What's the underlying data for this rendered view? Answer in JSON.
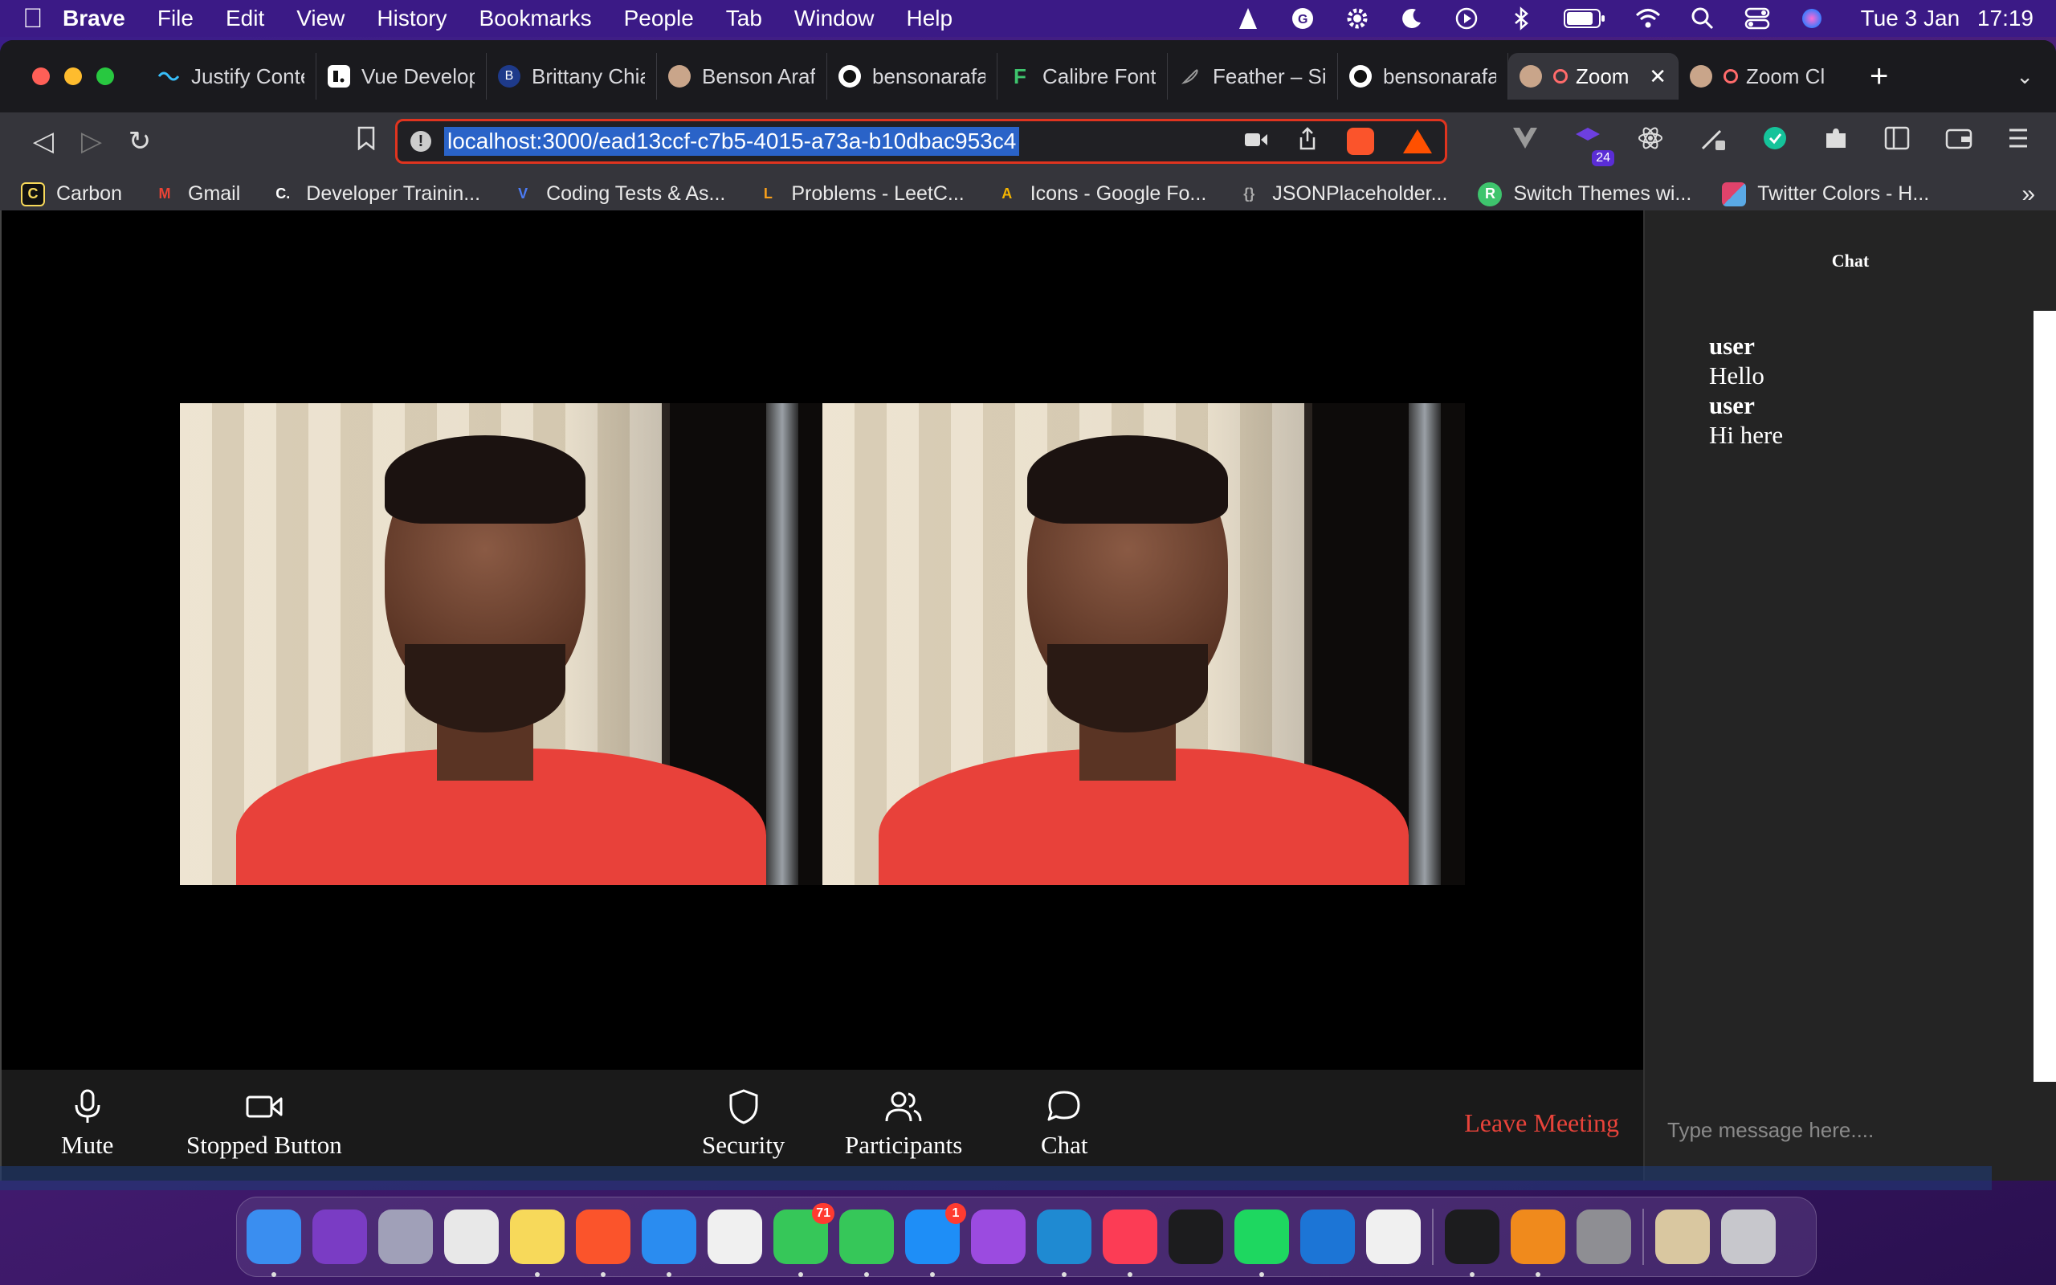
{
  "menubar": {
    "app_name": "Brave",
    "items": [
      "File",
      "Edit",
      "View",
      "History",
      "Bookmarks",
      "People",
      "Tab",
      "Window",
      "Help"
    ],
    "status_icons": [
      "vlc-icon",
      "grammarly-icon",
      "gear-icon",
      "moon-icon",
      "play-circle-icon",
      "bluetooth-icon",
      "battery-icon",
      "wifi-icon",
      "search-icon",
      "control-center-icon",
      "siri-icon"
    ],
    "date": "Tue 3 Jan",
    "time": "17:19"
  },
  "tabs": [
    {
      "label": "Justify Conte",
      "icon": "tailwind-icon",
      "color": "#38bdf8"
    },
    {
      "label": "Vue Develop",
      "icon": "vue-icon",
      "color": "#ffffff"
    },
    {
      "label": "Brittany Chia",
      "icon": "b-icon",
      "color": "#1e3a8a"
    },
    {
      "label": "Benson Araf",
      "icon": "avatar-icon",
      "color": "#c9a58a"
    },
    {
      "label": "bensonarafa",
      "icon": "github-icon",
      "color": "#ffffff"
    },
    {
      "label": "Calibre Font",
      "icon": "f-icon",
      "color": "#3ec46d"
    },
    {
      "label": "Feather – Sir",
      "icon": "feather-icon",
      "color": "#888888"
    },
    {
      "label": "bensonarafa",
      "icon": "github-icon",
      "color": "#ffffff"
    },
    {
      "label": "Zoom",
      "icon": "avatar-icon",
      "color": "#c9a58a",
      "active": true
    },
    {
      "label": "Zoom Cl",
      "icon": "avatar-icon",
      "color": "#c9a58a"
    }
  ],
  "toolbar": {
    "url": "localhost:3000/ead13ccf-c7b5-4015-a73a-b10dbac953c4",
    "extension_badge": "24"
  },
  "bookmarks": [
    {
      "label": "Carbon",
      "icon": "carbon-icon",
      "color": "#111111",
      "glyph": "C"
    },
    {
      "label": "Gmail",
      "icon": "gmail-icon",
      "color": "#ffffff",
      "glyph": "M"
    },
    {
      "label": "Developer Trainin...",
      "icon": "dev-icon",
      "color": "#2b2b2b",
      "glyph": "C"
    },
    {
      "label": "Coding Tests & As...",
      "icon": "code-icon",
      "color": "#2f5bd6",
      "glyph": "V"
    },
    {
      "label": "Problems - LeetC...",
      "icon": "leetcode-icon",
      "color": "#2b2b2b",
      "glyph": "L"
    },
    {
      "label": "Icons - Google Fo...",
      "icon": "google-fonts-icon",
      "color": "#f4b400",
      "glyph": "A"
    },
    {
      "label": "JSONPlaceholder...",
      "icon": "json-icon",
      "color": "#2b2b2b",
      "glyph": "{}"
    },
    {
      "label": "Switch Themes wi...",
      "icon": "r-icon",
      "color": "#3ec46d",
      "glyph": "R"
    },
    {
      "label": "Twitter Colors - H...",
      "icon": "palette-icon",
      "color": "#e0436b",
      "glyph": ""
    }
  ],
  "controls": {
    "mute": "Mute",
    "video": "Stopped Button",
    "security": "Security",
    "participants": "Participants",
    "chat": "Chat",
    "leave": "Leave Meeting"
  },
  "chat": {
    "title": "Chat",
    "messages": [
      {
        "user": "user",
        "text": "Hello"
      },
      {
        "user": "user",
        "text": "Hi here"
      }
    ],
    "placeholder": "Type message here...."
  },
  "dock": [
    {
      "name": "finder",
      "color": "#3a8ef0",
      "running": true
    },
    {
      "name": "siri",
      "color": "#7a3cc4",
      "running": false
    },
    {
      "name": "launchpad",
      "color": "#a0a0b8",
      "running": false
    },
    {
      "name": "chrome",
      "color": "#e8e8e8",
      "running": false
    },
    {
      "name": "notes",
      "color": "#f7d95a",
      "running": true
    },
    {
      "name": "brave",
      "color": "#fb542b",
      "running": true
    },
    {
      "name": "safari",
      "color": "#2a8cf0",
      "running": true
    },
    {
      "name": "photos",
      "color": "#f0f0f0",
      "running": false
    },
    {
      "name": "messages",
      "color": "#36c759",
      "running": true,
      "badge": "71"
    },
    {
      "name": "facetime",
      "color": "#36c759",
      "running": true
    },
    {
      "name": "app-store",
      "color": "#1e8ef7",
      "running": true,
      "badge": "1"
    },
    {
      "name": "podcasts",
      "color": "#9b4be0",
      "running": false
    },
    {
      "name": "vscode",
      "color": "#1f8ad2",
      "running": true
    },
    {
      "name": "music",
      "color": "#fc3c55",
      "running": true
    },
    {
      "name": "apple-tv",
      "color": "#1c1c1e",
      "running": false
    },
    {
      "name": "spotify",
      "color": "#1ed760",
      "running": true
    },
    {
      "name": "xcode",
      "color": "#1c75d6",
      "running": false
    },
    {
      "name": "mongodb",
      "color": "#f0f0f0",
      "running": false
    },
    {
      "name": "terminal",
      "color": "#1c1c1e",
      "running": true
    },
    {
      "name": "vlc",
      "color": "#f08a1c",
      "running": true
    },
    {
      "name": "system-preferences",
      "color": "#8e8e93",
      "running": false
    },
    {
      "name": "downloads",
      "color": "#d9c7a0",
      "running": false
    },
    {
      "name": "trash",
      "color": "#c7c7cc",
      "running": false
    }
  ]
}
